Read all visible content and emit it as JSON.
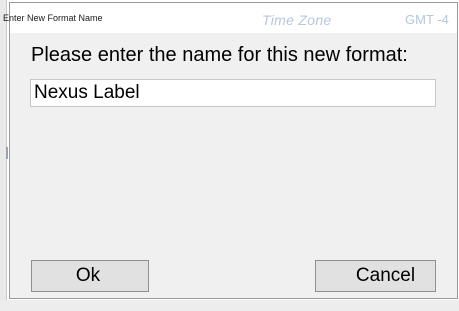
{
  "window": {
    "title": "Enter New Format Name"
  },
  "background_app": {
    "time_zone_label": "Time Zone",
    "time_zone_value": "GMT -4"
  },
  "dialog": {
    "prompt": "Please enter the name for this new format:",
    "format_name_value": "Nexus Label",
    "ok_label": "Ok",
    "cancel_label": "Cancel"
  }
}
